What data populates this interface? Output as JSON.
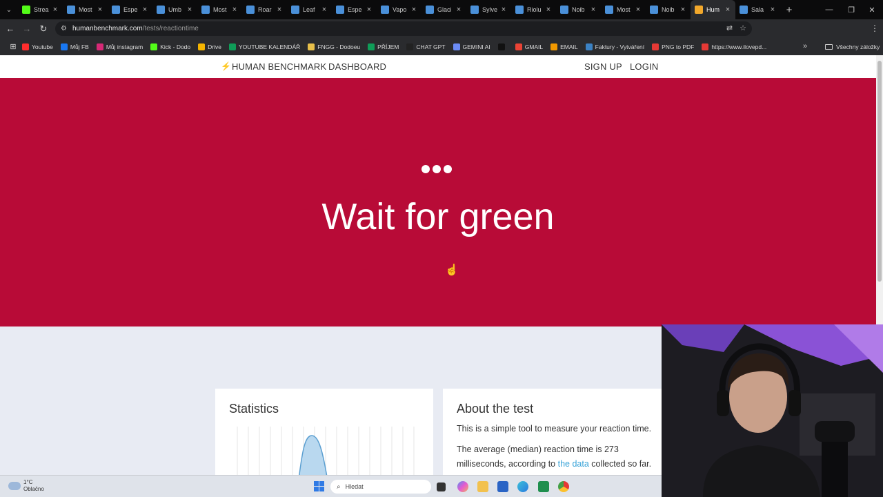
{
  "browser": {
    "tabs": [
      {
        "label": "Strea",
        "color": "#53fc18"
      },
      {
        "label": "Most",
        "color": "#4a90d9"
      },
      {
        "label": "Espe",
        "color": "#4a90d9"
      },
      {
        "label": "Umb",
        "color": "#4a90d9"
      },
      {
        "label": "Most",
        "color": "#4a90d9"
      },
      {
        "label": "Roar",
        "color": "#4a90d9"
      },
      {
        "label": "Leaf",
        "color": "#4a90d9"
      },
      {
        "label": "Espe",
        "color": "#4a90d9"
      },
      {
        "label": "Vapo",
        "color": "#4a90d9"
      },
      {
        "label": "Glaci",
        "color": "#4a90d9"
      },
      {
        "label": "Sylve",
        "color": "#4a90d9"
      },
      {
        "label": "Riolu",
        "color": "#4a90d9"
      },
      {
        "label": "Noib",
        "color": "#4a90d9"
      },
      {
        "label": "Most",
        "color": "#4a90d9"
      },
      {
        "label": "Noib",
        "color": "#4a90d9"
      },
      {
        "label": "Hum",
        "color": "#f2a82b",
        "active": true
      },
      {
        "label": "Sala",
        "color": "#4a90d9"
      }
    ],
    "url_host": "humanbenchmark.com",
    "url_path": "/tests/reactiontime",
    "bookmarks": [
      {
        "label": "Youtube",
        "color": "#ff2d2d"
      },
      {
        "label": "Můj FB",
        "color": "#1877f2"
      },
      {
        "label": "Můj instagram",
        "color": "#d62976"
      },
      {
        "label": "Kick - Dodo",
        "color": "#53fc18"
      },
      {
        "label": "Drive",
        "color": "#f4b400"
      },
      {
        "label": "YOUTUBE KALENDÁŘ",
        "color": "#0f9d58"
      },
      {
        "label": "FNGG - Dodoeu",
        "color": "#e8c04a"
      },
      {
        "label": "PŘÍJEM",
        "color": "#0f9d58"
      },
      {
        "label": "CHAT GPT",
        "color": "#222222"
      },
      {
        "label": "GEMINI AI",
        "color": "#6b8bf5"
      },
      {
        "label": "",
        "color": "#111111"
      },
      {
        "label": "GMAIL",
        "color": "#ea4335"
      },
      {
        "label": "EMAIL",
        "color": "#f29900"
      },
      {
        "label": "Faktury - Vytváření",
        "color": "#3b82c4"
      },
      {
        "label": "PNG to PDF",
        "color": "#e53935"
      },
      {
        "label": "https://www.ilovepd...",
        "color": "#e53935"
      }
    ],
    "all_bookmarks": "Všechny záložky"
  },
  "site": {
    "logo": "HUMAN BENCHMARK",
    "dashboard": "DASHBOARD",
    "signup": "SIGN UP",
    "login": "LOGIN",
    "hero_title": "Wait for green",
    "hero_color": "#b80b37"
  },
  "statistics": {
    "title": "Statistics"
  },
  "about": {
    "title": "About the test",
    "p1": "This is a simple tool to measure your reaction time.",
    "p2_pre": "The average (median) reaction time is 273 milliseconds, according to ",
    "p2_link": "the data",
    "p2_post": " collected so far."
  },
  "taskbar": {
    "temp": "1°C",
    "weather": "Oblačno",
    "search_placeholder": "Hledat"
  }
}
